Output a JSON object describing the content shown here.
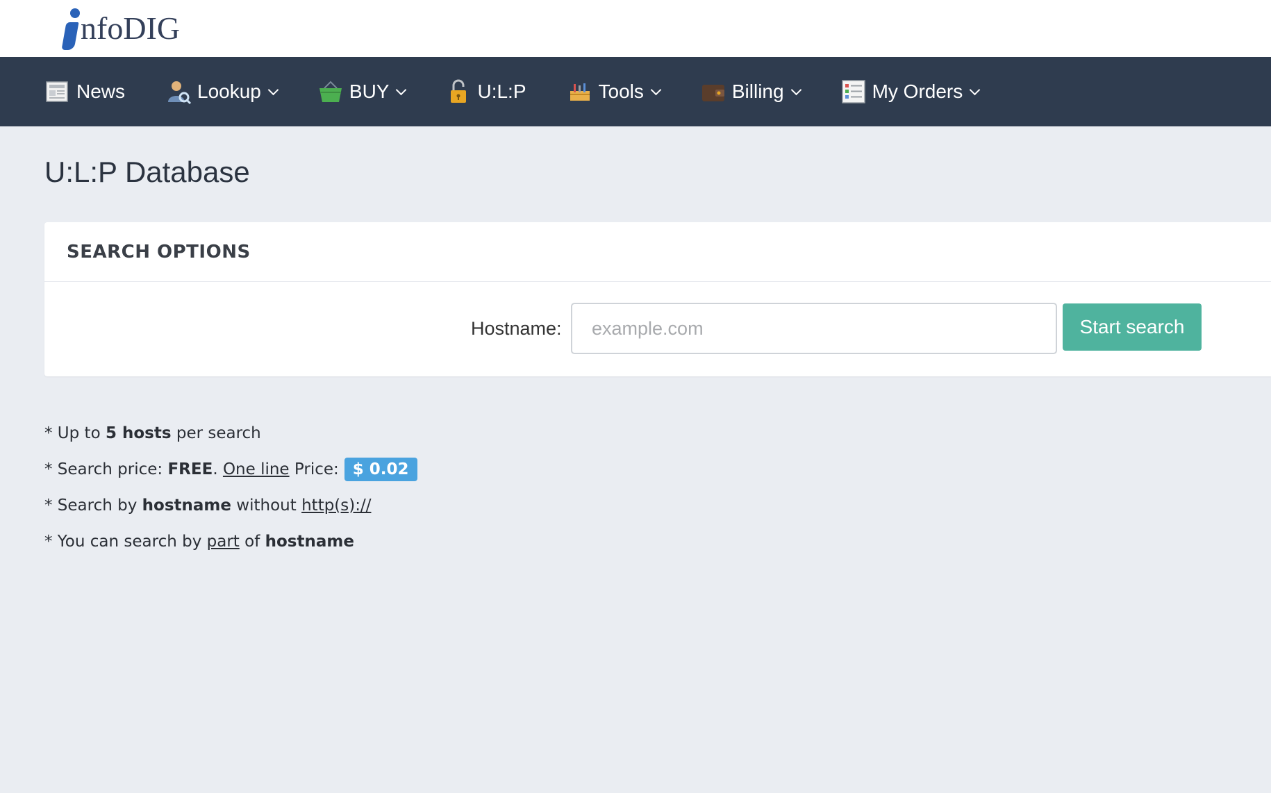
{
  "logo": {
    "initial": "i",
    "text": "nfoDIG"
  },
  "nav": {
    "items": [
      {
        "label": "News",
        "icon": "newspaper-icon",
        "dropdown": false
      },
      {
        "label": "Lookup",
        "icon": "user-search-icon",
        "dropdown": true
      },
      {
        "label": "BUY",
        "icon": "basket-icon",
        "dropdown": true
      },
      {
        "label": "U:L:P",
        "icon": "lock-icon",
        "dropdown": false
      },
      {
        "label": "Tools",
        "icon": "toolbox-icon",
        "dropdown": true
      },
      {
        "label": "Billing",
        "icon": "wallet-icon",
        "dropdown": true
      },
      {
        "label": "My Orders",
        "icon": "order-list-icon",
        "dropdown": true
      }
    ]
  },
  "page": {
    "title": "U:L:P Database"
  },
  "search": {
    "panel_title": "SEARCH OPTIONS",
    "hostname_label": "Hostname:",
    "hostname_placeholder": "example.com",
    "hostname_value": "",
    "button_label": "Start search"
  },
  "notes": {
    "n1": {
      "a": "* Up to ",
      "b": "5 hosts",
      "c": " per search"
    },
    "n2": {
      "a": "* Search price: ",
      "b": "FREE",
      "c": ". ",
      "d": "One line",
      "e": " Price:",
      "badge": "$ 0.02"
    },
    "n3": {
      "a": "* Search by ",
      "b": "hostname",
      "c": " without ",
      "d": "http(s)://"
    },
    "n4": {
      "a": "* You can search by ",
      "b": "part",
      "c": " of ",
      "d": "hostname"
    }
  },
  "colors": {
    "navbar": "#2f3c4f",
    "background": "#eaedf2",
    "button": "#4fb39e",
    "badge": "#4aa3df",
    "logo_accent": "#2a62b8"
  }
}
